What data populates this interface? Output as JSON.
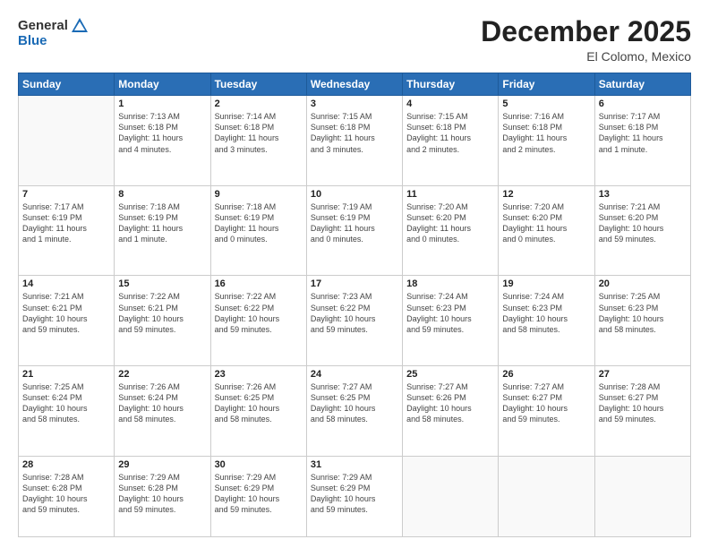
{
  "header": {
    "logo_general": "General",
    "logo_blue": "Blue",
    "title": "December 2025",
    "subtitle": "El Colomo, Mexico"
  },
  "weekdays": [
    "Sunday",
    "Monday",
    "Tuesday",
    "Wednesday",
    "Thursday",
    "Friday",
    "Saturday"
  ],
  "weeks": [
    [
      {
        "day": "",
        "info": ""
      },
      {
        "day": "1",
        "info": "Sunrise: 7:13 AM\nSunset: 6:18 PM\nDaylight: 11 hours\nand 4 minutes."
      },
      {
        "day": "2",
        "info": "Sunrise: 7:14 AM\nSunset: 6:18 PM\nDaylight: 11 hours\nand 3 minutes."
      },
      {
        "day": "3",
        "info": "Sunrise: 7:15 AM\nSunset: 6:18 PM\nDaylight: 11 hours\nand 3 minutes."
      },
      {
        "day": "4",
        "info": "Sunrise: 7:15 AM\nSunset: 6:18 PM\nDaylight: 11 hours\nand 2 minutes."
      },
      {
        "day": "5",
        "info": "Sunrise: 7:16 AM\nSunset: 6:18 PM\nDaylight: 11 hours\nand 2 minutes."
      },
      {
        "day": "6",
        "info": "Sunrise: 7:17 AM\nSunset: 6:18 PM\nDaylight: 11 hours\nand 1 minute."
      }
    ],
    [
      {
        "day": "7",
        "info": "Sunrise: 7:17 AM\nSunset: 6:19 PM\nDaylight: 11 hours\nand 1 minute."
      },
      {
        "day": "8",
        "info": "Sunrise: 7:18 AM\nSunset: 6:19 PM\nDaylight: 11 hours\nand 1 minute."
      },
      {
        "day": "9",
        "info": "Sunrise: 7:18 AM\nSunset: 6:19 PM\nDaylight: 11 hours\nand 0 minutes."
      },
      {
        "day": "10",
        "info": "Sunrise: 7:19 AM\nSunset: 6:19 PM\nDaylight: 11 hours\nand 0 minutes."
      },
      {
        "day": "11",
        "info": "Sunrise: 7:20 AM\nSunset: 6:20 PM\nDaylight: 11 hours\nand 0 minutes."
      },
      {
        "day": "12",
        "info": "Sunrise: 7:20 AM\nSunset: 6:20 PM\nDaylight: 11 hours\nand 0 minutes."
      },
      {
        "day": "13",
        "info": "Sunrise: 7:21 AM\nSunset: 6:20 PM\nDaylight: 10 hours\nand 59 minutes."
      }
    ],
    [
      {
        "day": "14",
        "info": "Sunrise: 7:21 AM\nSunset: 6:21 PM\nDaylight: 10 hours\nand 59 minutes."
      },
      {
        "day": "15",
        "info": "Sunrise: 7:22 AM\nSunset: 6:21 PM\nDaylight: 10 hours\nand 59 minutes."
      },
      {
        "day": "16",
        "info": "Sunrise: 7:22 AM\nSunset: 6:22 PM\nDaylight: 10 hours\nand 59 minutes."
      },
      {
        "day": "17",
        "info": "Sunrise: 7:23 AM\nSunset: 6:22 PM\nDaylight: 10 hours\nand 59 minutes."
      },
      {
        "day": "18",
        "info": "Sunrise: 7:24 AM\nSunset: 6:23 PM\nDaylight: 10 hours\nand 59 minutes."
      },
      {
        "day": "19",
        "info": "Sunrise: 7:24 AM\nSunset: 6:23 PM\nDaylight: 10 hours\nand 58 minutes."
      },
      {
        "day": "20",
        "info": "Sunrise: 7:25 AM\nSunset: 6:23 PM\nDaylight: 10 hours\nand 58 minutes."
      }
    ],
    [
      {
        "day": "21",
        "info": "Sunrise: 7:25 AM\nSunset: 6:24 PM\nDaylight: 10 hours\nand 58 minutes."
      },
      {
        "day": "22",
        "info": "Sunrise: 7:26 AM\nSunset: 6:24 PM\nDaylight: 10 hours\nand 58 minutes."
      },
      {
        "day": "23",
        "info": "Sunrise: 7:26 AM\nSunset: 6:25 PM\nDaylight: 10 hours\nand 58 minutes."
      },
      {
        "day": "24",
        "info": "Sunrise: 7:27 AM\nSunset: 6:25 PM\nDaylight: 10 hours\nand 58 minutes."
      },
      {
        "day": "25",
        "info": "Sunrise: 7:27 AM\nSunset: 6:26 PM\nDaylight: 10 hours\nand 58 minutes."
      },
      {
        "day": "26",
        "info": "Sunrise: 7:27 AM\nSunset: 6:27 PM\nDaylight: 10 hours\nand 59 minutes."
      },
      {
        "day": "27",
        "info": "Sunrise: 7:28 AM\nSunset: 6:27 PM\nDaylight: 10 hours\nand 59 minutes."
      }
    ],
    [
      {
        "day": "28",
        "info": "Sunrise: 7:28 AM\nSunset: 6:28 PM\nDaylight: 10 hours\nand 59 minutes."
      },
      {
        "day": "29",
        "info": "Sunrise: 7:29 AM\nSunset: 6:28 PM\nDaylight: 10 hours\nand 59 minutes."
      },
      {
        "day": "30",
        "info": "Sunrise: 7:29 AM\nSunset: 6:29 PM\nDaylight: 10 hours\nand 59 minutes."
      },
      {
        "day": "31",
        "info": "Sunrise: 7:29 AM\nSunset: 6:29 PM\nDaylight: 10 hours\nand 59 minutes."
      },
      {
        "day": "",
        "info": ""
      },
      {
        "day": "",
        "info": ""
      },
      {
        "day": "",
        "info": ""
      }
    ]
  ]
}
